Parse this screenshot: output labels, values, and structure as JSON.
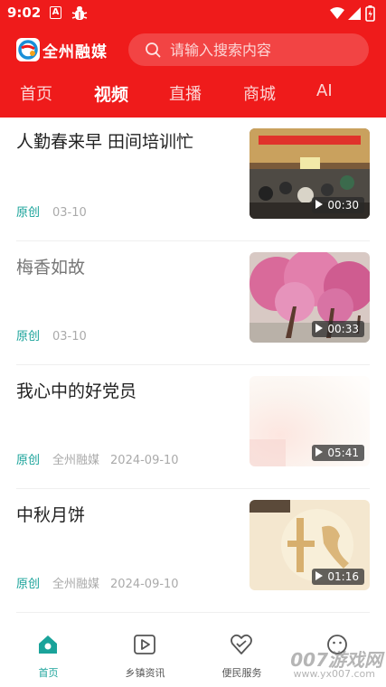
{
  "status_bar": {
    "time": "9:02",
    "notif_a": "A"
  },
  "header": {
    "logo_text": "全州融媒",
    "search_placeholder": "请输入搜索内容",
    "tabs": [
      {
        "label": "首页"
      },
      {
        "label": "视频",
        "active": true
      },
      {
        "label": "直播"
      },
      {
        "label": "商城"
      },
      {
        "label": "AI"
      }
    ]
  },
  "items": [
    {
      "title": "人勤春来早 田间培训忙",
      "tag": "原创",
      "source": "",
      "date": "03-10",
      "duration": "00:30"
    },
    {
      "title": "梅香如故",
      "tag": "原创",
      "source": "",
      "date": "03-10",
      "duration": "00:33"
    },
    {
      "title": "我心中的好党员",
      "tag": "原创",
      "source": "全州融媒",
      "date": "2024-09-10",
      "duration": "05:41"
    },
    {
      "title": "中秋月饼",
      "tag": "原创",
      "source": "全州融媒",
      "date": "2024-09-10",
      "duration": "01:16"
    }
  ],
  "bottom_nav": [
    {
      "label": "首页",
      "icon": "home-icon",
      "active": true
    },
    {
      "label": "乡镇资讯",
      "icon": "play-square-icon"
    },
    {
      "label": "便民服务",
      "icon": "heart-hands-icon"
    },
    {
      "label": "",
      "icon": "smile-icon"
    }
  ],
  "watermark": {
    "text": "007游戏网",
    "url": "www.yx007.com"
  },
  "colors": {
    "brand_red": "#ef1b1b",
    "accent_teal": "#1aa39a"
  }
}
